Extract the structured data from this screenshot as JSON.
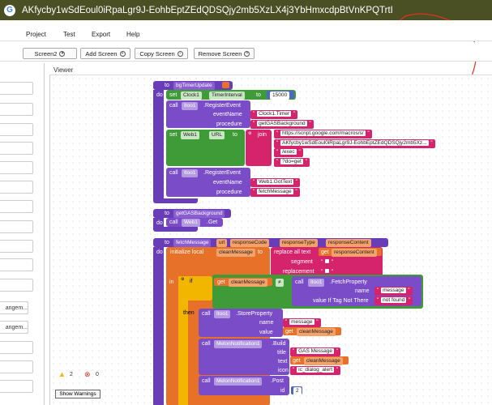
{
  "url": {
    "text": "AKfycby1wSdEoul0iRpaLgr9J-EohbEptZEdQDSQjy2mb5XzLX4j3YbHmxcdpBtVnKPQTrtI",
    "icon": "google-g-icon"
  },
  "menu": {
    "items": [
      "Project",
      "Test",
      "Export",
      "Help"
    ]
  },
  "toolbar": {
    "screen_btn": "Screen2",
    "add_screen": "Add Screen",
    "copy_screen": "Copy Screen",
    "remove_screen": "Remove Screen"
  },
  "left_panel": {
    "items": [
      "",
      "",
      "",
      "",
      "",
      "",
      "",
      "",
      "",
      "",
      "",
      "angem...",
      "angem...",
      "",
      "",
      "",
      "",
      ""
    ]
  },
  "viewer_label": "Viewer",
  "blocks": {
    "proc1": {
      "to": "to",
      "name": "bgTimerUpdate",
      "do": "do"
    },
    "set_clock": {
      "set": "set",
      "comp": "Clock1",
      "prop": "TimerInterval",
      "to": "to",
      "val": "15000"
    },
    "call_reg1": {
      "call": "call",
      "comp": "Itoo1",
      "method": ".RegisterEvent",
      "arg1": "eventName",
      "arg2": "procedure",
      "val1": "Clock1.Timer",
      "val2": "getGASBackground"
    },
    "set_web": {
      "set": "set",
      "comp": "Web1",
      "prop": "URL",
      "to": "to",
      "join": "join",
      "s1": "https://script.google.com/macros/s/",
      "s2": "AKfycby1wSdEoul0iRpaLgr9J-EohbEptZEdQDSQjy2mb5Xz...",
      "s3": "/exec",
      "s4": "?do=get"
    },
    "call_reg2": {
      "call": "call",
      "comp": "Itoo1",
      "method": ".RegisterEvent",
      "arg1": "eventName",
      "arg2": "procedure",
      "val1": "Web1.GotText",
      "val2": "fetchMessage"
    },
    "proc2": {
      "to": "to",
      "name": "getGASBackground",
      "do": "do",
      "call": "call",
      "comp": "Web1",
      "method": ".Get"
    },
    "proc3": {
      "to": "to",
      "name": "fetchMessage",
      "p0": "url",
      "p1": "responseCode",
      "p2": "responseType",
      "p3": "responseContent",
      "do": "do"
    },
    "init": {
      "label": "initialize local",
      "var": "cleanMessage",
      "to": "to",
      "replace": "replace all text",
      "get": "get",
      "rc": "responseContent",
      "seg": "segment",
      "rep": "replacement",
      "in": "in"
    },
    "if": {
      "if": "if",
      "get": "get",
      "var": "cleanMessage",
      "op": "≠",
      "call": "call",
      "comp": "Itoo1",
      "method": ".FetchProperty",
      "name": "name",
      "name_val": "message",
      "value_if": "value If Tag Not There",
      "nf": "not found",
      "then": "then"
    },
    "store": {
      "call": "call",
      "comp": "Itoo1",
      "method": ".StoreProperty",
      "name": "name",
      "value": "value",
      "nv": "message",
      "get": "get",
      "var": "cleanMessage"
    },
    "build": {
      "call": "call",
      "comp": "MelonNotification1",
      "method": ".Build",
      "title": "title",
      "text": "text",
      "icon": "icon",
      "tv": "GAS Message",
      "get": "get",
      "var": "cleanMessage",
      "iv": "ic_dialog_alert"
    },
    "post": {
      "call": "call",
      "comp": "MelonNotification1",
      "method": ".Post",
      "id": "id",
      "idv": "2"
    }
  },
  "warnings": {
    "warn_count": "2",
    "err_count": "0",
    "button": "Show Warnings"
  },
  "colors": {
    "urlbar": "#4a4f24",
    "procedure": "#6a3db8",
    "set": "#3f9a38",
    "text": "#d6246c",
    "variable": "#e8712a",
    "control": "#f2b600"
  }
}
